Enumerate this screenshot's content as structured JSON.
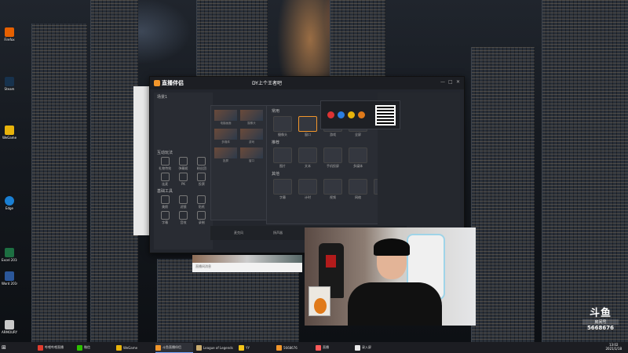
{
  "desktop": {
    "icons": [
      {
        "label": "Firefox",
        "color": "#e66000"
      },
      {
        "label": "Steam",
        "color": "#17324d"
      },
      {
        "label": "WeGame",
        "color": "#e8b30b"
      },
      {
        "label": "Edge",
        "color": "#1a7fd3"
      },
      {
        "label": "Excel 2016",
        "color": "#1d6f42"
      },
      {
        "label": "Word 2016",
        "color": "#2b579a"
      },
      {
        "label": "ARMOURY CRATE",
        "color": "#c9c9c9"
      }
    ]
  },
  "app": {
    "title": "直播伴侣",
    "streamer": "DY上个王者吧",
    "window_controls": [
      "—",
      "□",
      "✕"
    ],
    "sidebar": {
      "scene_label": "场景1",
      "sections": [
        {
          "title": "互动玩法",
          "tools": [
            "礼物特效",
            "弹幕姬",
            "粉丝团",
            "连麦",
            "PK",
            "投票"
          ]
        },
        {
          "title": "基础工具",
          "tools": [
            "美颜",
            "滤镜",
            "贴纸",
            "字幕",
            "音效",
            "录制"
          ]
        }
      ]
    },
    "thumb_labels": [
      "电脑画面",
      "摄像头",
      "多媒体",
      "游戏",
      "投屏",
      "窗口"
    ],
    "source_panel": {
      "sections": [
        {
          "title": "常用",
          "items": [
            "摄像头",
            "窗口",
            "游戏",
            "全屏"
          ],
          "active": 1
        },
        {
          "title": "推荐",
          "items": [
            "图片",
            "文本",
            "手机投屏",
            "多媒体"
          ]
        },
        {
          "title": "其他",
          "items": [
            "字幕",
            "计时",
            "视频",
            "网络",
            "更多"
          ]
        }
      ]
    },
    "bottom_bar": [
      "麦克风",
      "扬声器"
    ],
    "accent": "#f2962b"
  },
  "notification": {
    "text": "直播间消息"
  },
  "watermark": {
    "brand": "斗鱼",
    "room_label": "房间号",
    "room_number": "5668676"
  },
  "taskbar": {
    "items": [
      {
        "label": "哔哩哔哩直播",
        "color": "#e13c2f"
      },
      {
        "label": "微信",
        "color": "#2dc100"
      },
      {
        "label": "WeGame",
        "color": "#e8b30b"
      },
      {
        "label": "斗鱼直播伴侣",
        "color": "#f2962b",
        "active": true
      },
      {
        "label": "League of Legends",
        "color": "#c8aa6e"
      },
      {
        "label": "YY",
        "color": "#f5c518"
      },
      {
        "label": "5668676",
        "color": "#f2962b"
      },
      {
        "label": "直播",
        "color": "#ff5a5a"
      },
      {
        "label": "录入屏",
        "color": "#e9e9e9"
      }
    ],
    "time": "13:02",
    "date": "2021/1/18"
  }
}
